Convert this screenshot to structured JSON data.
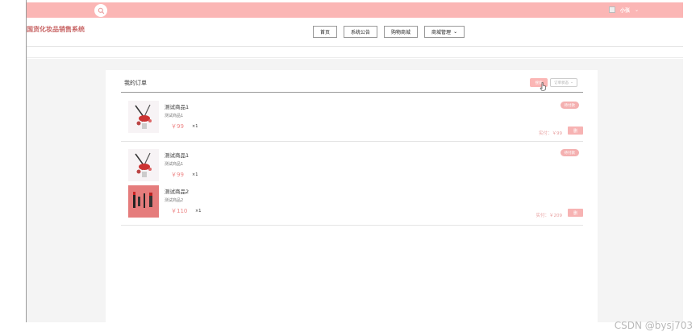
{
  "header": {
    "site_title": "国货化妆品销售系统",
    "user_name": "小张",
    "search_icon": "search-icon"
  },
  "nav": {
    "items": [
      {
        "label": "首页"
      },
      {
        "label": "系统公告"
      },
      {
        "label": "购物商城"
      },
      {
        "label": "商城管理"
      }
    ]
  },
  "orders_page": {
    "title": "我的订单",
    "search_button": "搜索",
    "status_filter_placeholder": "订单状态",
    "orders": [
      {
        "status": "待付款",
        "items": [
          {
            "name": "测试商品1",
            "desc": "测试商品1",
            "price": "￥99",
            "qty": "×1",
            "image": "cosmetic"
          }
        ],
        "total": "实付：￥99",
        "delete_label": "删"
      },
      {
        "status": "待付款",
        "items": [
          {
            "name": "测试商品1",
            "desc": "测试商品1",
            "price": "￥99",
            "qty": "×1",
            "image": "cosmetic"
          },
          {
            "name": "测试商品2",
            "desc": "测试商品2",
            "price": "￥110",
            "qty": "×1",
            "image": "red"
          }
        ],
        "total": "实付：￥209",
        "delete_label": "删"
      }
    ]
  },
  "watermark": "CSDN @bysj703",
  "colors": {
    "brand_pink": "#fbb6b5",
    "title_red": "#c86565",
    "price_pink": "#e88888"
  }
}
